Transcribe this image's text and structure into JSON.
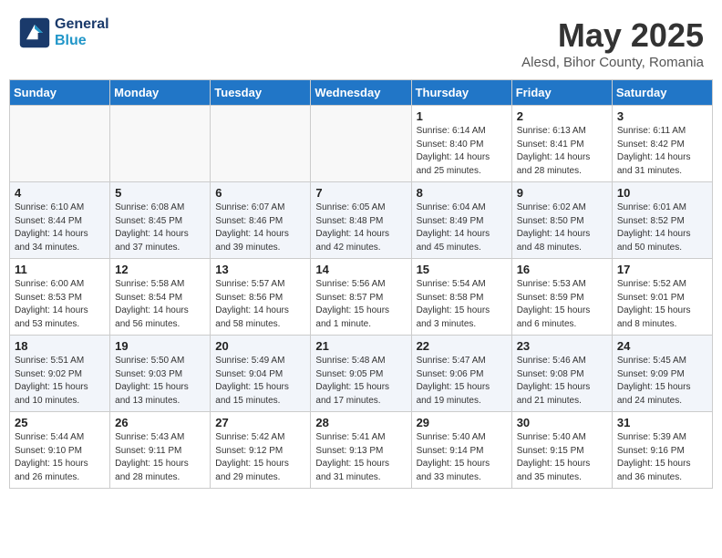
{
  "header": {
    "logo_line1": "General",
    "logo_line2": "Blue",
    "title": "May 2025",
    "subtitle": "Alesd, Bihor County, Romania"
  },
  "weekdays": [
    "Sunday",
    "Monday",
    "Tuesday",
    "Wednesday",
    "Thursday",
    "Friday",
    "Saturday"
  ],
  "weeks": [
    [
      {
        "day": "",
        "info": ""
      },
      {
        "day": "",
        "info": ""
      },
      {
        "day": "",
        "info": ""
      },
      {
        "day": "",
        "info": ""
      },
      {
        "day": "1",
        "info": "Sunrise: 6:14 AM\nSunset: 8:40 PM\nDaylight: 14 hours\nand 25 minutes."
      },
      {
        "day": "2",
        "info": "Sunrise: 6:13 AM\nSunset: 8:41 PM\nDaylight: 14 hours\nand 28 minutes."
      },
      {
        "day": "3",
        "info": "Sunrise: 6:11 AM\nSunset: 8:42 PM\nDaylight: 14 hours\nand 31 minutes."
      }
    ],
    [
      {
        "day": "4",
        "info": "Sunrise: 6:10 AM\nSunset: 8:44 PM\nDaylight: 14 hours\nand 34 minutes."
      },
      {
        "day": "5",
        "info": "Sunrise: 6:08 AM\nSunset: 8:45 PM\nDaylight: 14 hours\nand 37 minutes."
      },
      {
        "day": "6",
        "info": "Sunrise: 6:07 AM\nSunset: 8:46 PM\nDaylight: 14 hours\nand 39 minutes."
      },
      {
        "day": "7",
        "info": "Sunrise: 6:05 AM\nSunset: 8:48 PM\nDaylight: 14 hours\nand 42 minutes."
      },
      {
        "day": "8",
        "info": "Sunrise: 6:04 AM\nSunset: 8:49 PM\nDaylight: 14 hours\nand 45 minutes."
      },
      {
        "day": "9",
        "info": "Sunrise: 6:02 AM\nSunset: 8:50 PM\nDaylight: 14 hours\nand 48 minutes."
      },
      {
        "day": "10",
        "info": "Sunrise: 6:01 AM\nSunset: 8:52 PM\nDaylight: 14 hours\nand 50 minutes."
      }
    ],
    [
      {
        "day": "11",
        "info": "Sunrise: 6:00 AM\nSunset: 8:53 PM\nDaylight: 14 hours\nand 53 minutes."
      },
      {
        "day": "12",
        "info": "Sunrise: 5:58 AM\nSunset: 8:54 PM\nDaylight: 14 hours\nand 56 minutes."
      },
      {
        "day": "13",
        "info": "Sunrise: 5:57 AM\nSunset: 8:56 PM\nDaylight: 14 hours\nand 58 minutes."
      },
      {
        "day": "14",
        "info": "Sunrise: 5:56 AM\nSunset: 8:57 PM\nDaylight: 15 hours\nand 1 minute."
      },
      {
        "day": "15",
        "info": "Sunrise: 5:54 AM\nSunset: 8:58 PM\nDaylight: 15 hours\nand 3 minutes."
      },
      {
        "day": "16",
        "info": "Sunrise: 5:53 AM\nSunset: 8:59 PM\nDaylight: 15 hours\nand 6 minutes."
      },
      {
        "day": "17",
        "info": "Sunrise: 5:52 AM\nSunset: 9:01 PM\nDaylight: 15 hours\nand 8 minutes."
      }
    ],
    [
      {
        "day": "18",
        "info": "Sunrise: 5:51 AM\nSunset: 9:02 PM\nDaylight: 15 hours\nand 10 minutes."
      },
      {
        "day": "19",
        "info": "Sunrise: 5:50 AM\nSunset: 9:03 PM\nDaylight: 15 hours\nand 13 minutes."
      },
      {
        "day": "20",
        "info": "Sunrise: 5:49 AM\nSunset: 9:04 PM\nDaylight: 15 hours\nand 15 minutes."
      },
      {
        "day": "21",
        "info": "Sunrise: 5:48 AM\nSunset: 9:05 PM\nDaylight: 15 hours\nand 17 minutes."
      },
      {
        "day": "22",
        "info": "Sunrise: 5:47 AM\nSunset: 9:06 PM\nDaylight: 15 hours\nand 19 minutes."
      },
      {
        "day": "23",
        "info": "Sunrise: 5:46 AM\nSunset: 9:08 PM\nDaylight: 15 hours\nand 21 minutes."
      },
      {
        "day": "24",
        "info": "Sunrise: 5:45 AM\nSunset: 9:09 PM\nDaylight: 15 hours\nand 24 minutes."
      }
    ],
    [
      {
        "day": "25",
        "info": "Sunrise: 5:44 AM\nSunset: 9:10 PM\nDaylight: 15 hours\nand 26 minutes."
      },
      {
        "day": "26",
        "info": "Sunrise: 5:43 AM\nSunset: 9:11 PM\nDaylight: 15 hours\nand 28 minutes."
      },
      {
        "day": "27",
        "info": "Sunrise: 5:42 AM\nSunset: 9:12 PM\nDaylight: 15 hours\nand 29 minutes."
      },
      {
        "day": "28",
        "info": "Sunrise: 5:41 AM\nSunset: 9:13 PM\nDaylight: 15 hours\nand 31 minutes."
      },
      {
        "day": "29",
        "info": "Sunrise: 5:40 AM\nSunset: 9:14 PM\nDaylight: 15 hours\nand 33 minutes."
      },
      {
        "day": "30",
        "info": "Sunrise: 5:40 AM\nSunset: 9:15 PM\nDaylight: 15 hours\nand 35 minutes."
      },
      {
        "day": "31",
        "info": "Sunrise: 5:39 AM\nSunset: 9:16 PM\nDaylight: 15 hours\nand 36 minutes."
      }
    ]
  ]
}
